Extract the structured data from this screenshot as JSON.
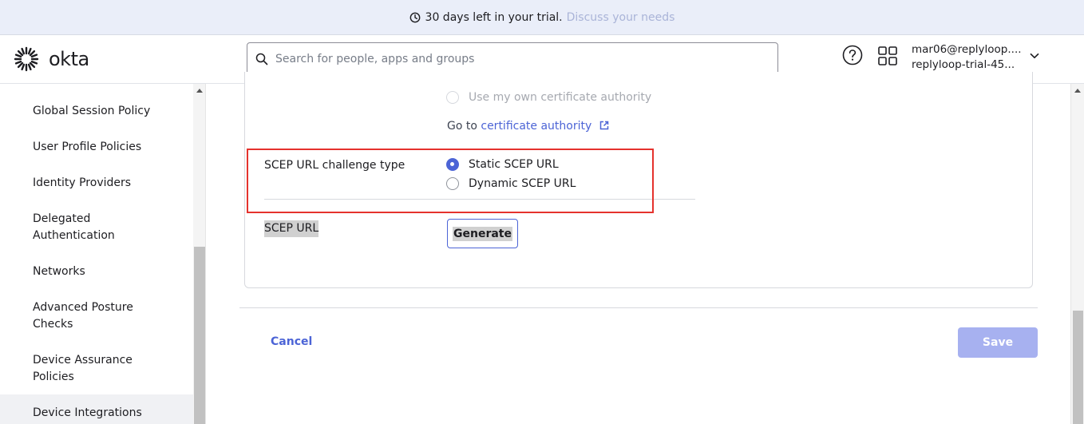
{
  "banner": {
    "trial_text": "30 days left in your trial.",
    "link_text": "Discuss your needs",
    "icon": "clock-icon"
  },
  "header": {
    "logo_text": "okta",
    "search_placeholder": "Search for people, apps and groups",
    "user_email": "mar06@replyloop....",
    "user_org": "replyloop-trial-45..."
  },
  "sidebar": {
    "items": [
      {
        "label": "Global Session Policy"
      },
      {
        "label": "User Profile Policies"
      },
      {
        "label": "Identity Providers"
      },
      {
        "label": "Delegated Authentication"
      },
      {
        "label": "Networks"
      },
      {
        "label": "Advanced Posture Checks"
      },
      {
        "label": "Device Assurance Policies"
      },
      {
        "label": "Device Integrations"
      }
    ]
  },
  "form": {
    "own_ca_label": "Use my own certificate authority",
    "goto_prefix": "Go to",
    "goto_link": "certificate authority",
    "scep_challenge_label": "SCEP URL challenge type",
    "options": [
      {
        "label": "Static SCEP URL",
        "checked": true
      },
      {
        "label": "Dynamic SCEP URL",
        "checked": false
      }
    ],
    "scep_url_label": "SCEP URL",
    "generate_label": "Generate"
  },
  "footer": {
    "cancel_label": "Cancel",
    "save_label": "Save"
  },
  "colors": {
    "accent": "#4c64d6",
    "highlight": "#e5322d",
    "save_disabled": "#a7b1f0"
  }
}
